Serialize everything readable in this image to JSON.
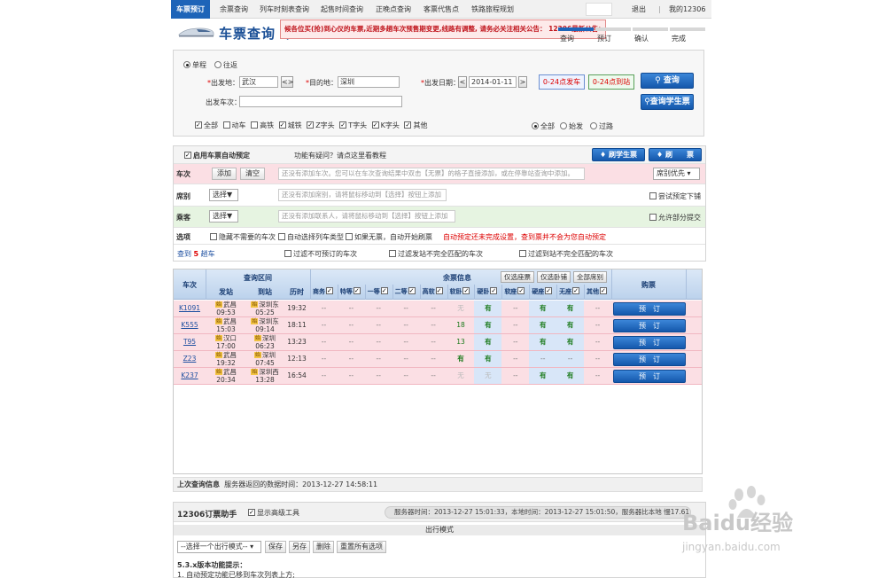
{
  "nav": {
    "items": [
      "车票预订",
      "余票查询",
      "列车时刻表查询",
      "起售时间查询",
      "正晚点查询",
      "客票代售点",
      "铁路旅程规划"
    ],
    "logout": "退出",
    "account": "我的12306"
  },
  "header": {
    "title": "车票查询（",
    "notice": "候各位买(抢)到心仪的车票,近期多趟车次预售期变更,线路有调整, 请务必关注相关公告： 12306最新公告:",
    "steps": [
      "查询",
      "预订",
      "确认",
      "完成"
    ]
  },
  "query": {
    "trip_types": [
      "单程",
      "往返"
    ],
    "from_label": "出发地：",
    "from_value": "武汉",
    "swap_label": "<>",
    "to_label": "目的地：",
    "to_value": "深圳",
    "date_label": "出发日期：",
    "date_prev": "<",
    "date_value": "2014-01-11",
    "date_next": ">",
    "depart_time": "0-24点发车",
    "arrive_time": "0-24点到站",
    "search_label": "查询",
    "student_label": "查询学生票",
    "train_no_label": "出发车次：",
    "train_no_value": "",
    "train_types": [
      "全部",
      "动车",
      "高铁",
      "城铁",
      "Z字头",
      "T字头",
      "K字头",
      "其他"
    ],
    "station_filters": [
      "全部",
      "始发",
      "过路"
    ]
  },
  "auto": {
    "enable_label": "启用车票自动预定",
    "help_text": "功能有疑问？请点这里看教程",
    "student_btn": "刷学生票",
    "refresh_btn": "刷　　票",
    "train_label": "车次",
    "add_label": "添加",
    "clear_label": "清空",
    "train_hint": "还没有添加车次。您可以在车次查询结果中双击【无票】的格子直接添加，或在停靠站查询中添加。",
    "priority_label": "席别优先",
    "seat_label": "席别",
    "select_label": "选择▼",
    "seat_hint": "还没有添加席别，请将鼠标移动到【选择】按钮上添加",
    "try_lower_label": "尝试预定下铺",
    "passenger_label": "乘客",
    "passenger_hint": "还没有添加联系人，请将鼠标移动到【选择】按钮上添加",
    "partial_label": "允许部分提交",
    "option_label": "选项",
    "opt_hide": "隐藏不需要的车次",
    "opt_auto_type": "自动选择列车类型",
    "opt_refresh": "如果无票，自动开始刷票",
    "warning": "自动预定还未完成设置，查到票并不会为您自动预定",
    "result_prefix": "查到",
    "result_count": "5",
    "result_suffix": "趟车",
    "filter_unbookable": "过滤不可预订的车次",
    "filter_dep_mismatch": "过滤发站不完全匹配的车次",
    "filter_arr_mismatch": "过滤到站不完全匹配的车次"
  },
  "table": {
    "col_train": "车次",
    "col_interval": "查询区间",
    "col_from": "发站",
    "col_to": "到站",
    "col_duration": "历时",
    "col_remain": "余票信息",
    "btn_only_bookable": "仅选座票",
    "btn_only_sleeper": "仅选卧铺",
    "btn_all_seats": "全部席别",
    "col_book": "购票",
    "seat_types": [
      "商务",
      "特等",
      "一等",
      "二等",
      "高软",
      "软卧",
      "硬卧",
      "软座",
      "硬座",
      "无座",
      "其他"
    ],
    "book_label": "预　订",
    "start_tag": "始",
    "rows": [
      {
        "train": "K1091",
        "from": "武昌",
        "dep": "09:53",
        "to": "深圳东",
        "arr": "05:25",
        "duration": "19:32",
        "seats": [
          "--",
          "--",
          "--",
          "--",
          "--",
          "无",
          "有",
          "--",
          "有",
          "有",
          "--"
        ]
      },
      {
        "train": "K555",
        "from": "武昌",
        "dep": "15:03",
        "to": "深圳东",
        "arr": "09:14",
        "duration": "18:11",
        "seats": [
          "--",
          "--",
          "--",
          "--",
          "--",
          "18",
          "有",
          "--",
          "有",
          "有",
          "--"
        ]
      },
      {
        "train": "T95",
        "from": "汉口",
        "dep": "17:00",
        "to": "深圳",
        "arr": "06:23",
        "duration": "13:23",
        "seats": [
          "--",
          "--",
          "--",
          "--",
          "--",
          "13",
          "有",
          "--",
          "有",
          "有",
          "--"
        ]
      },
      {
        "train": "Z23",
        "from": "武昌",
        "dep": "19:32",
        "to": "深圳",
        "arr": "07:45",
        "duration": "12:13",
        "seats": [
          "--",
          "--",
          "--",
          "--",
          "--",
          "有",
          "有",
          "--",
          "--",
          "--",
          "--"
        ]
      },
      {
        "train": "K237",
        "from": "武昌",
        "dep": "20:34",
        "to": "深圳西",
        "arr": "13:28",
        "duration": "16:54",
        "seats": [
          "--",
          "--",
          "--",
          "--",
          "--",
          "无",
          "无",
          "--",
          "有",
          "有",
          "--"
        ]
      }
    ]
  },
  "lastq": {
    "label": "上次查询信息",
    "text": "服务器返回的数据时间：2013-12-27 14:58:11"
  },
  "helper": {
    "title": "12306订票助手",
    "show_adv": "显示高级工具",
    "server_time": "服务器时间：2013-12-27 15:01:33，本地时间：2013-12-27 15:01:50，服务器比本地 慢17.61",
    "mode_title": "出行模式",
    "mode_select": "--选择一个出行模式--",
    "save": "保存",
    "save_as": "另存",
    "delete": "删除",
    "reset": "重置所有选项",
    "version_title": "5.3.x版本功能提示：",
    "version_item": "1. 自动预定功能已移到车次列表上方;"
  },
  "watermark": {
    "brand": "Baidu经验",
    "url": "jingyan.baidu.com"
  },
  "colors": {
    "brand_blue": "#1e64b8",
    "table_pink": "#fbdfe4",
    "notice_red": "#c0141c"
  }
}
